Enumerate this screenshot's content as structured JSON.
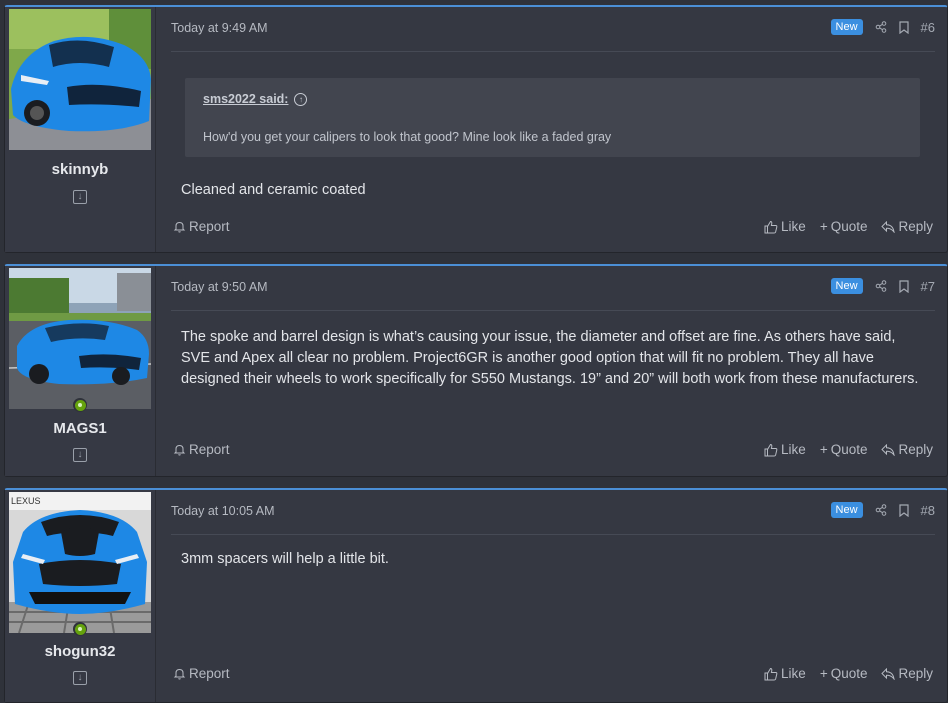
{
  "posts": [
    {
      "username": "skinnyb",
      "online": false,
      "timestamp": "Today at 9:49 AM",
      "badge": "New",
      "post_number": "#6",
      "quote": {
        "author": "sms2022 said:",
        "text": "How'd you get your calipers to look that good? Mine look like a faded gray"
      },
      "message": "Cleaned and ceramic coated",
      "actions": {
        "report": "Report",
        "like": "Like",
        "quote": "Quote",
        "reply": "Reply"
      }
    },
    {
      "username": "MAGS1",
      "online": true,
      "timestamp": "Today at 9:50 AM",
      "badge": "New",
      "post_number": "#7",
      "message": "The spoke and barrel design is what’s causing your issue, the diameter and offset are fine. As others have said, SVE and Apex all clear no problem. Project6GR is another good option that will fit no problem. They all have designed their wheels to work specifically for S550 Mustangs. 19” and 20” will both work from these manufacturers.",
      "actions": {
        "report": "Report",
        "like": "Like",
        "quote": "Quote",
        "reply": "Reply"
      }
    },
    {
      "username": "shogun32",
      "online": true,
      "timestamp": "Today at 10:05 AM",
      "badge": "New",
      "post_number": "#8",
      "avatar_sign": "LEXUS",
      "message": "3mm spacers will help a little bit.",
      "actions": {
        "report": "Report",
        "like": "Like",
        "quote": "Quote",
        "reply": "Reply"
      }
    }
  ],
  "colors": {
    "accent": "#3b8fe0",
    "car_blue": "#1e88e5",
    "online": "#65a30d"
  },
  "icons": [
    "share-icon",
    "bookmark-icon",
    "bell-icon",
    "thumbs-up-icon",
    "plus-icon",
    "reply-icon",
    "download-icon",
    "arrow-up-circle-icon",
    "online-status-icon"
  ]
}
